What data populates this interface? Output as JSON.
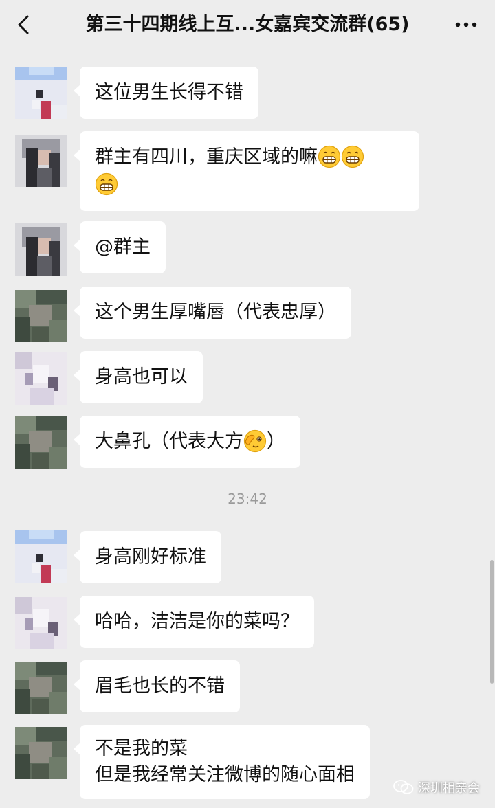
{
  "header": {
    "title": "第三十四期线上互...女嘉宾交流群(65)",
    "back_icon": "chevron-left-icon",
    "more_icon": "more-icon"
  },
  "messages": [
    {
      "text": "这位男生长得不错",
      "avatar": "blue-avatar"
    },
    {
      "text_line1": "群主有四川，重庆区域的嘛",
      "emoji": "grinning-face",
      "avatar": "dark-hair-avatar"
    },
    {
      "text": "@群主",
      "avatar": "dark-hair-avatar"
    },
    {
      "text": "这个男生厚嘴唇（代表忠厚）",
      "avatar": "green-avatar"
    },
    {
      "text": "身高也可以",
      "avatar": "light-avatar"
    },
    {
      "text_pre": "大鼻孔（代表大方",
      "emoji": "face-covering-eye",
      "text_post": "）",
      "avatar": "green-avatar"
    },
    {
      "text": "身高刚好标准",
      "avatar": "blue-avatar"
    },
    {
      "text": "哈哈，洁洁是你的菜吗？",
      "avatar": "light-avatar"
    },
    {
      "text": "眉毛也长的不错",
      "avatar": "green-avatar"
    },
    {
      "line1": "不是我的菜",
      "line2": "但是我经常关注微博的随心面相",
      "avatar": "green-avatar"
    }
  ],
  "timestamp": "23:42",
  "watermark": {
    "text": "深圳相亲会",
    "icon": "wechat-icon"
  },
  "colors": {
    "background": "#ededed",
    "bubble": "#ffffff",
    "timestamp": "#9a9a9a"
  }
}
